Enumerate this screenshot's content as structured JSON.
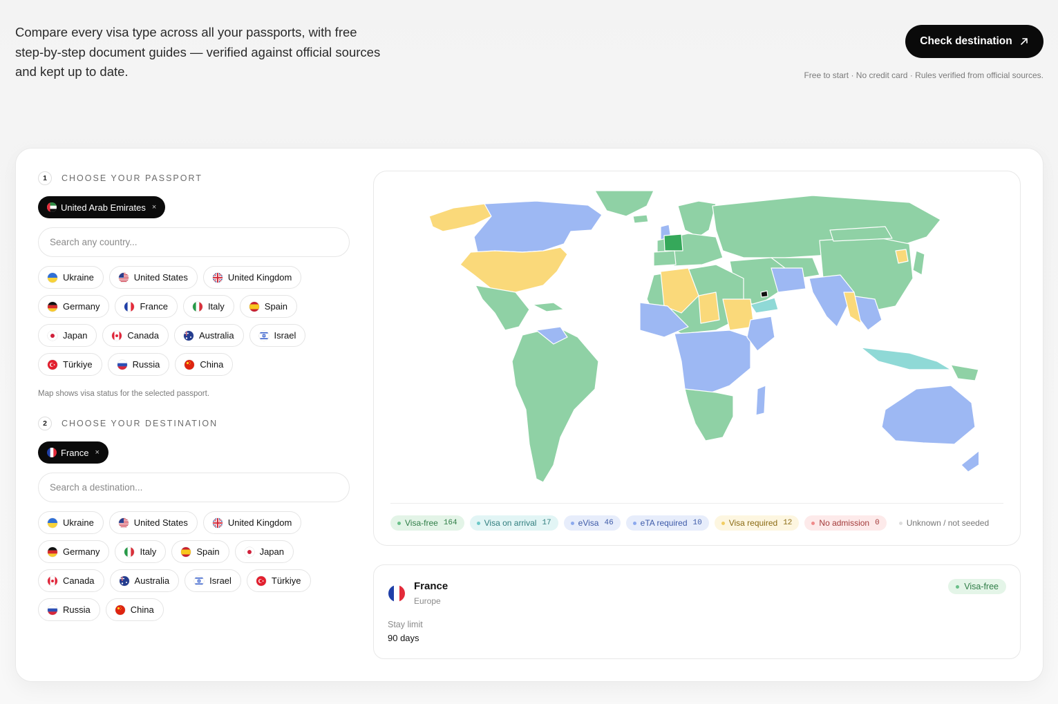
{
  "hero": {
    "intro": "Compare every visa type across all your passports, with free step-by-step document guides — verified against official sources and kept up to date.",
    "cta_label": "Check destination",
    "cta_note": "Free to start · No credit card · Rules verified from official sources."
  },
  "passport": {
    "step_number": "1",
    "step_title": "CHOOSE YOUR PASSPORT",
    "selected": "United Arab Emirates",
    "search_placeholder": "Search any country...",
    "options": [
      "Ukraine",
      "United States",
      "United Kingdom",
      "Germany",
      "France",
      "Italy",
      "Spain",
      "Japan",
      "Canada",
      "Australia",
      "Israel",
      "Türkiye",
      "Russia",
      "China"
    ],
    "note": "Map shows visa status for the selected passport."
  },
  "destination": {
    "step_number": "2",
    "step_title": "CHOOSE YOUR DESTINATION",
    "selected": "France",
    "search_placeholder": "Search a destination...",
    "options": [
      "Ukraine",
      "United States",
      "United Kingdom",
      "Germany",
      "Italy",
      "Spain",
      "Japan",
      "Canada",
      "Australia",
      "Israel",
      "Türkiye",
      "Russia",
      "China"
    ]
  },
  "legend": [
    {
      "label": "Visa-free",
      "count": "164",
      "bg": "#e3f4e7",
      "fg": "#2f7d47",
      "dot": "#6ac089"
    },
    {
      "label": "Visa on arrival",
      "count": "17",
      "bg": "#e2f5f5",
      "fg": "#2f7d7d",
      "dot": "#6cc9c9"
    },
    {
      "label": "eVisa",
      "count": "46",
      "bg": "#e7edfb",
      "fg": "#3d5aa8",
      "dot": "#8ca9ee"
    },
    {
      "label": "eTA required",
      "count": "10",
      "bg": "#e7edfb",
      "fg": "#3d5aa8",
      "dot": "#8ca9ee"
    },
    {
      "label": "Visa required",
      "count": "12",
      "bg": "#fdf6e0",
      "fg": "#8a6a12",
      "dot": "#f2cd62"
    },
    {
      "label": "No admission",
      "count": "0",
      "bg": "#fdeaea",
      "fg": "#a33a3a",
      "dot": "#f08a8a"
    },
    {
      "label": "Unknown / not seeded",
      "count": "",
      "bg": "#ffffff",
      "fg": "#777777",
      "dot": "#dddddd"
    }
  ],
  "map_colors": {
    "visa_free": "#8fd1a5",
    "visa_on_arrival": "#8fd9d6",
    "evisa": "#9db8f3",
    "visa_required": "#fad97a",
    "selected": "#35a85a",
    "origin": "#111111"
  },
  "result": {
    "name": "France",
    "region": "Europe",
    "status": "Visa-free",
    "stay_label": "Stay limit",
    "stay_value": "90 days"
  }
}
